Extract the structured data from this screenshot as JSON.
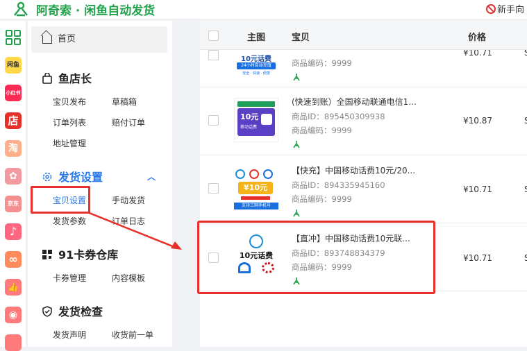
{
  "header": {
    "brand": "阿奇索 · 闲鱼自动发货",
    "help": "新手向"
  },
  "rail": [
    {
      "name": "apps",
      "text": "",
      "color": "#ffffff"
    },
    {
      "name": "xianyu",
      "text": "闲鱼",
      "color": "#ffd84a"
    },
    {
      "name": "xiaohongshu",
      "text": "小红书",
      "color": "#fe2c55"
    },
    {
      "name": "store",
      "text": "店",
      "color": "#e8302a"
    },
    {
      "name": "taobao",
      "text": "淘",
      "color": "#ff8a5c"
    },
    {
      "name": "pinduoduo",
      "text": "✿",
      "color": "#f07a80"
    },
    {
      "name": "jd",
      "text": "京东",
      "color": "#f06a6a"
    },
    {
      "name": "douyin",
      "text": "♪",
      "color": "#ff6680"
    },
    {
      "name": "kuaishou",
      "text": "∞",
      "color": "#ff8a5c"
    },
    {
      "name": "like",
      "text": "👍",
      "color": "#ff6f6f"
    },
    {
      "name": "bag",
      "text": "◉",
      "color": "#ff6f6f"
    }
  ],
  "sidebar": {
    "home": "首页",
    "groups": [
      {
        "title": "鱼店长",
        "items": [
          "宝贝发布",
          "草稿箱",
          "订单列表",
          "赔付订单",
          "地址管理"
        ]
      },
      {
        "title": "发货设置",
        "items": [
          "宝贝设置",
          "手动发货",
          "发货参数",
          "订单日志"
        ]
      },
      {
        "title": "91卡券仓库",
        "items": [
          "卡券管理",
          "内容模板"
        ]
      },
      {
        "title": "发货检查",
        "items": [
          "发货声明",
          "收货前一单"
        ]
      }
    ]
  },
  "table": {
    "headers": {
      "image": "主图",
      "item": "宝贝",
      "price": "价格"
    },
    "rows": [
      {
        "title": "",
        "id_label": "",
        "code_label": "商品编码：9999",
        "price": "¥10.71",
        "edge": "S",
        "thumb_text": "10元话费",
        "thumb_sub": "24小时自动充值",
        "thumb_tags": "安全 · 快速 · 便捷"
      },
      {
        "title": "(快速到账）全国移动联通电信1...",
        "id_label": "商品ID：895450309938",
        "code_label": "商品编码：9999",
        "price": "¥10.87",
        "edge": "S",
        "thumb_text": "10元",
        "thumb_sub": "移动话费"
      },
      {
        "title": "【快充】中国移动话费10元/20...",
        "id_label": "商品ID：894335945160",
        "code_label": "商品编码：9999",
        "price": "¥10.71",
        "edge": "S",
        "thumb_text": "¥10元",
        "thumb_sub": "支持三网手机号"
      },
      {
        "title": "【直冲】中国移动话费10元联...",
        "id_label": "商品ID：893748834379",
        "code_label": "商品编码：9999",
        "price": "¥10.71",
        "edge": "S",
        "thumb_text": "10元话费",
        "thumb_sub": ""
      }
    ]
  },
  "colors": {
    "brand": "#21a14a",
    "accent": "#2878e8",
    "highlight": "#e8302a"
  }
}
